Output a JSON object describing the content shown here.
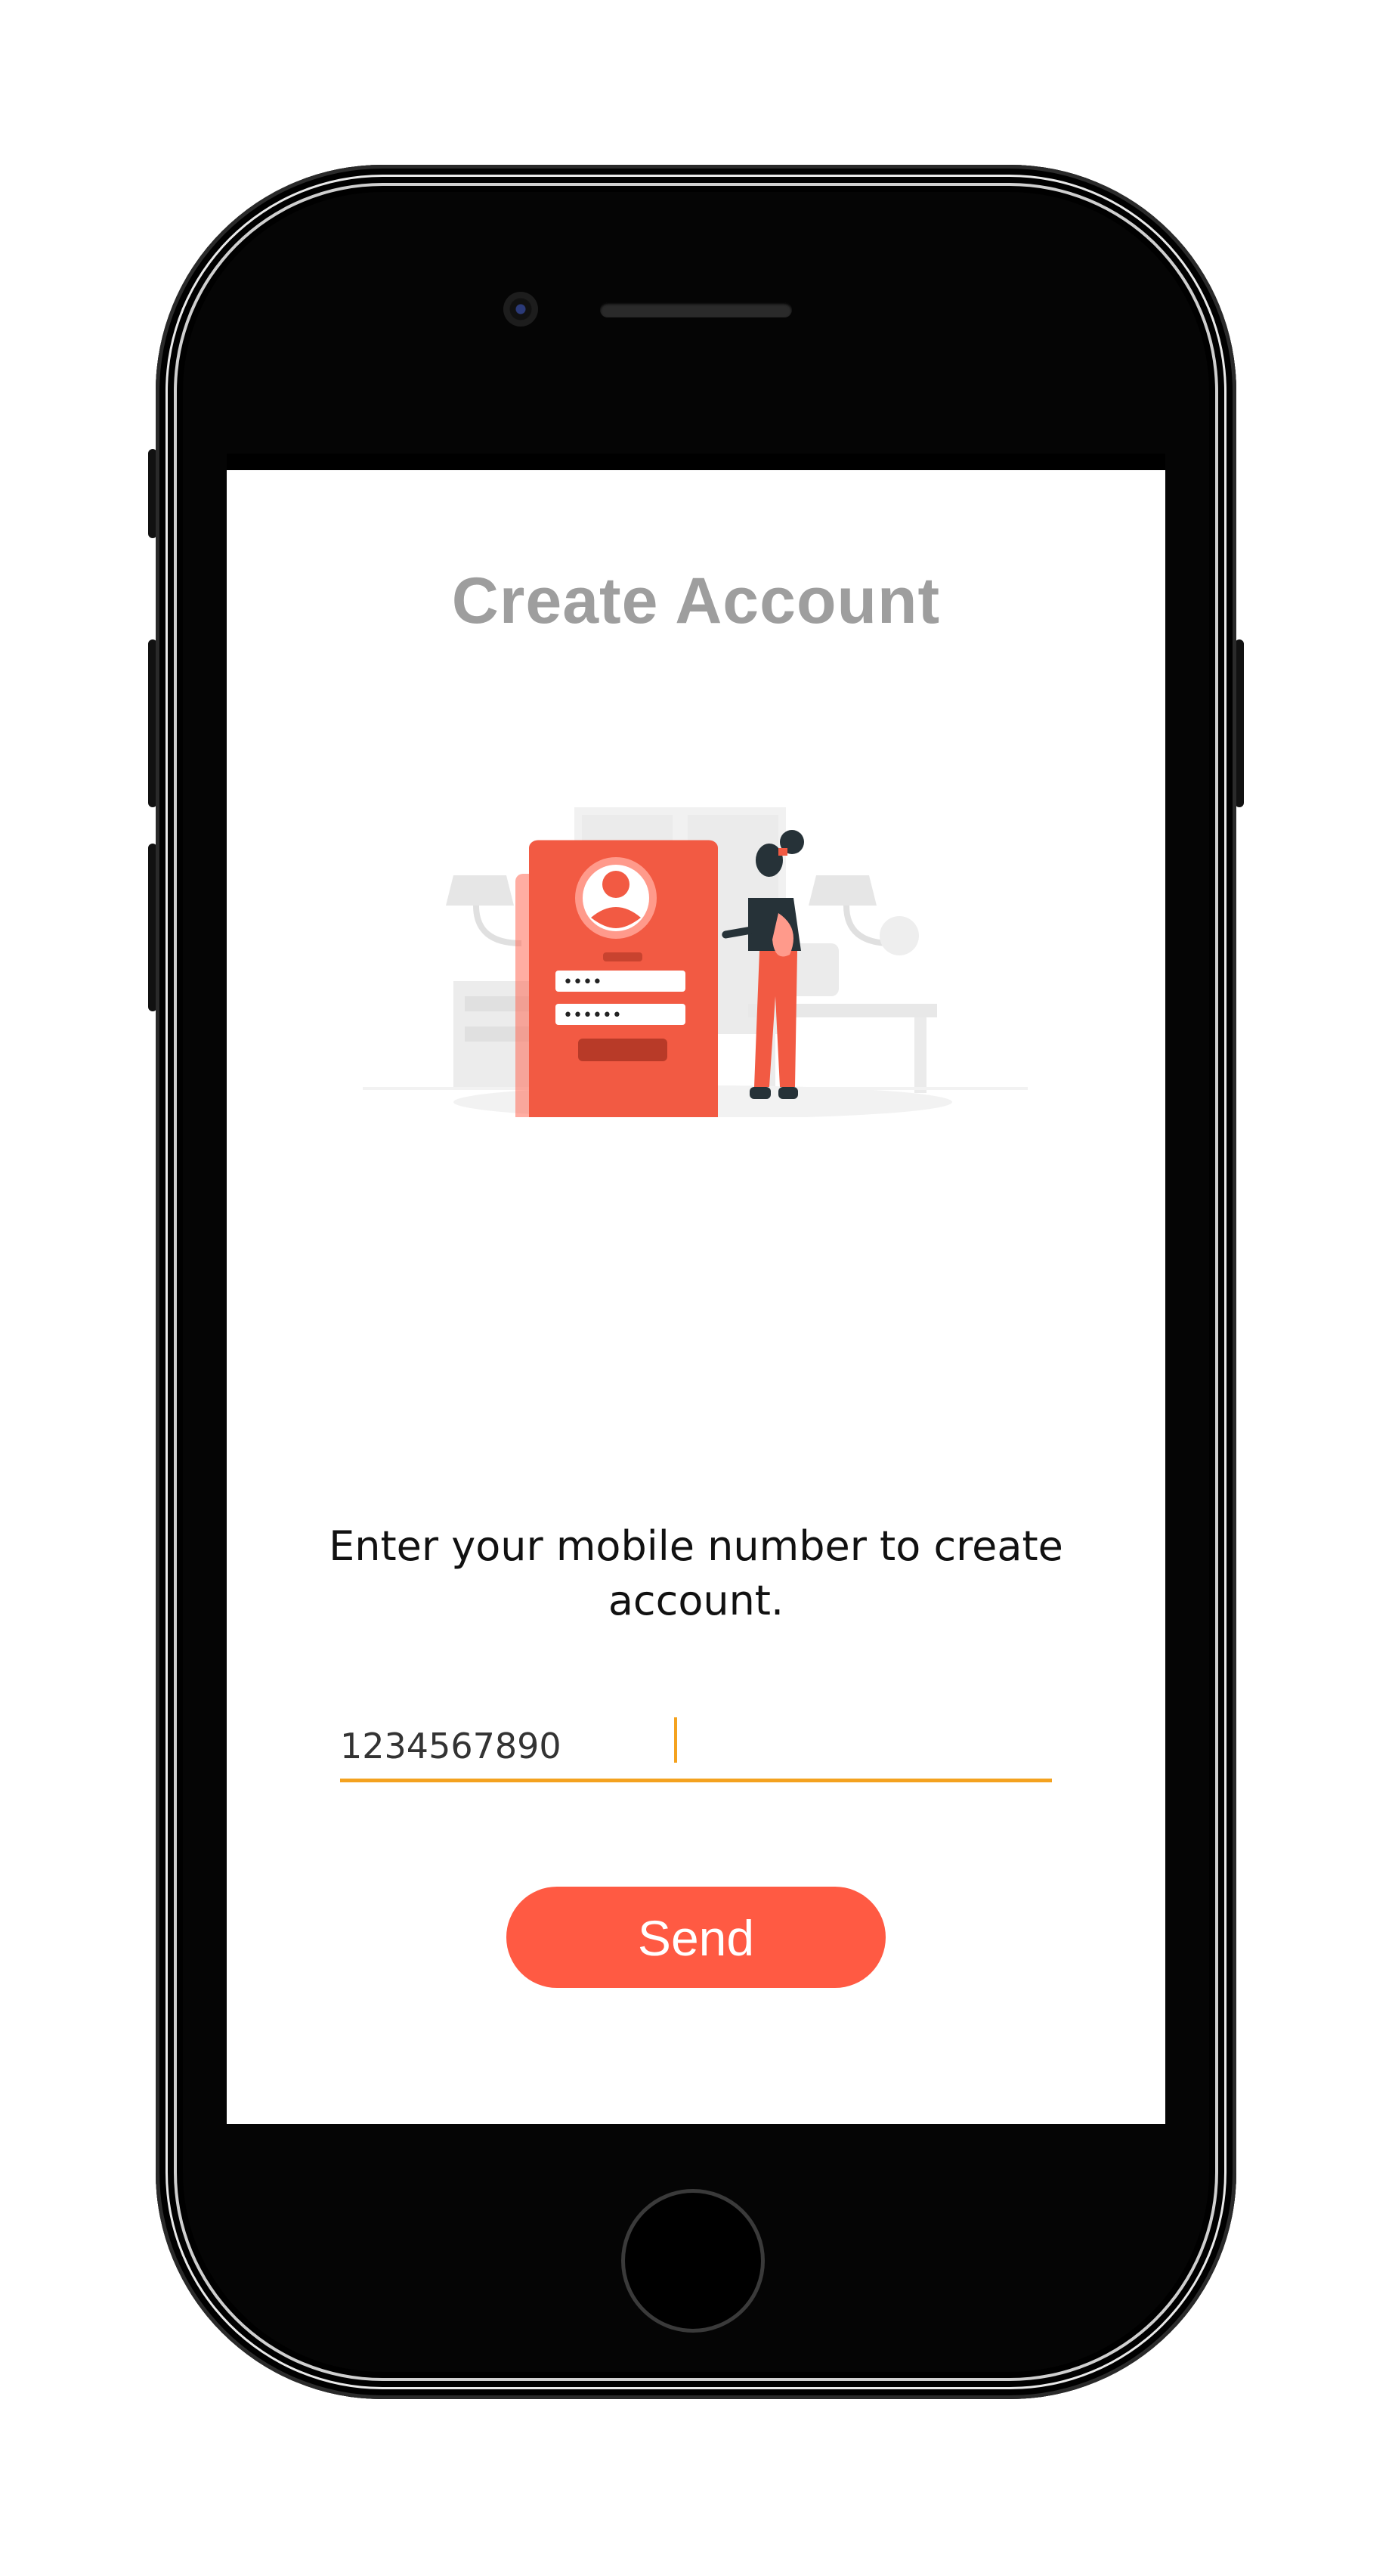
{
  "screen": {
    "title": "Create Account",
    "description": "Enter your mobile number to create account.",
    "phone_input": {
      "value": "1234567890",
      "placeholder": ""
    },
    "send_label": "Send"
  },
  "illustration": {
    "name": "sign-up-illustration",
    "form_field_1_mask": "••••",
    "form_field_2_mask": "••••••"
  },
  "colors": {
    "accent": "#ff5a43",
    "input_underline": "#f4a21f",
    "title_gray": "#9e9e9e"
  }
}
